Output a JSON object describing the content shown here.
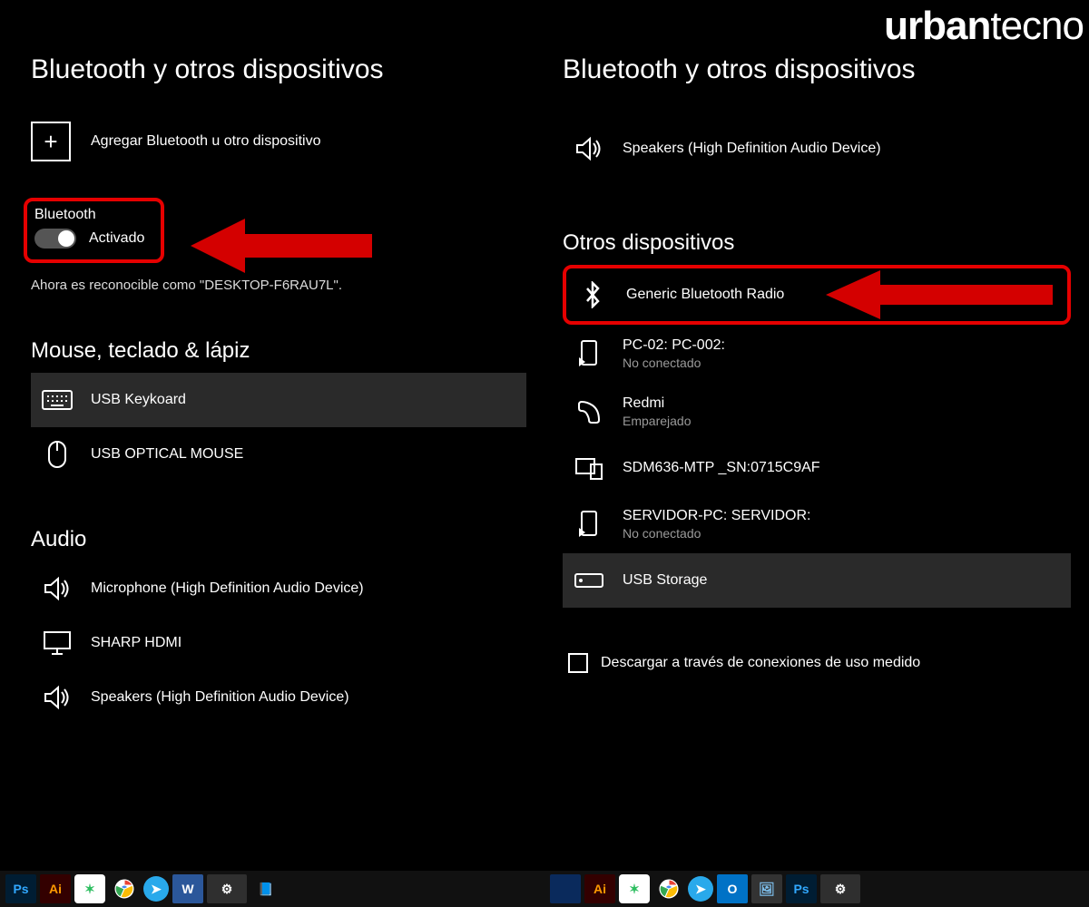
{
  "watermark": {
    "bold": "urban",
    "light": "tecno"
  },
  "left": {
    "title": "Bluetooth y otros dispositivos",
    "add_label": "Agregar Bluetooth u otro dispositivo",
    "bluetooth_label": "Bluetooth",
    "bluetooth_state": "Activado",
    "discoverable_text": "Ahora es reconocible como \"DESKTOP-F6RAU7L\".",
    "sections": {
      "mouse": {
        "heading": "Mouse, teclado & lápiz",
        "items": [
          {
            "name": "USB Keykoard",
            "icon": "keyboard",
            "selected": true
          },
          {
            "name": "USB OPTICAL MOUSE",
            "icon": "mouse"
          }
        ]
      },
      "audio": {
        "heading": "Audio",
        "items": [
          {
            "name": "Microphone (High Definition Audio Device)",
            "icon": "speaker"
          },
          {
            "name": "SHARP HDMI",
            "icon": "monitor"
          },
          {
            "name": "Speakers (High Definition Audio Device)",
            "icon": "speaker"
          }
        ]
      }
    }
  },
  "right": {
    "title": "Bluetooth y otros dispositivos",
    "top_device": {
      "name": "Speakers (High Definition Audio Device)",
      "icon": "speaker"
    },
    "section_heading": "Otros dispositivos",
    "items": [
      {
        "name": "Generic Bluetooth Radio",
        "icon": "bluetooth",
        "highlight": true
      },
      {
        "name": "PC-02: PC-002:",
        "status": "No conectado",
        "icon": "cast"
      },
      {
        "name": "Redmi",
        "status": "Emparejado",
        "icon": "phone"
      },
      {
        "name": "SDM636-MTP _SN:0715C9AF",
        "icon": "devices"
      },
      {
        "name": "SERVIDOR-PC: SERVIDOR:",
        "status": "No conectado",
        "icon": "cast"
      },
      {
        "name": "USB Storage",
        "icon": "storage",
        "selected": true
      }
    ],
    "checkbox_label": "Descargar a través de conexiones de uso medido"
  },
  "taskbar": {
    "left": [
      "ps",
      "ai",
      "ev",
      "chrome",
      "tg",
      "word",
      "gear",
      "note"
    ],
    "right": [
      "blank",
      "ai",
      "ev",
      "chrome",
      "tg",
      "out",
      "pic",
      "ps",
      "gear",
      "blank"
    ]
  },
  "colors": {
    "highlight": "#e60000",
    "arrow": "#d40000"
  }
}
